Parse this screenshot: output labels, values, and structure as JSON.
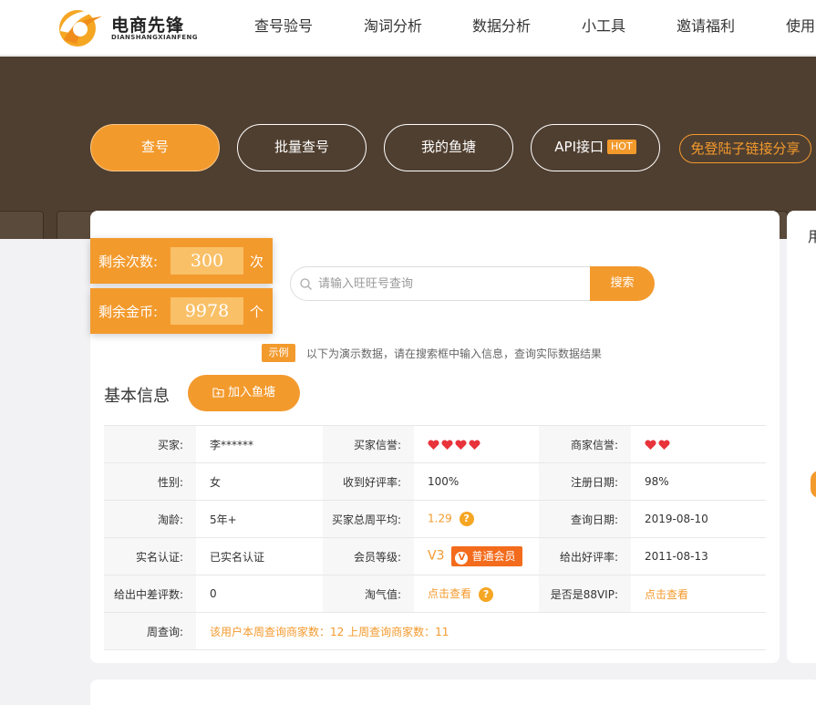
{
  "brand": {
    "name": "电商先锋",
    "sub": "DIANSHANGXIANFENG"
  },
  "nav": {
    "items": [
      "查号验号",
      "淘词分析",
      "数据分析",
      "小工具",
      "邀请福利",
      "使用"
    ]
  },
  "hero": {
    "tabs": [
      {
        "label": "查号"
      },
      {
        "label": "批量查号"
      },
      {
        "label": "我的鱼塘"
      },
      {
        "label": "API接口",
        "badge": "HOT"
      }
    ],
    "share": "免登陆子链接分享"
  },
  "stats": {
    "remaining_count": {
      "label": "剩余次数:",
      "value": "300",
      "unit": "次"
    },
    "remaining_coins": {
      "label": "剩余金币:",
      "value": "9978",
      "unit": "个"
    }
  },
  "search": {
    "placeholder": "请输入旺旺号查询",
    "button": "搜索"
  },
  "demo": {
    "tag": "示例",
    "text": "以下为演示数据，请在搜索框中输入信息，查询实际数据结果"
  },
  "basic": {
    "title": "基本信息",
    "add_button": "加入鱼塘"
  },
  "table": {
    "buyer_label": "买家:",
    "buyer": "李******",
    "buyer_credit_label": "买家信誉:",
    "seller_credit_label": "商家信誉:",
    "gender_label": "性别:",
    "gender": "女",
    "good_rate_label": "收到好评率:",
    "good_rate": "100%",
    "reg_date_label": "注册日期:",
    "reg_date": "98%",
    "age_label": "淘龄:",
    "age": "5年+",
    "weekly_avg_label": "买家总周平均:",
    "weekly_avg": "1.29",
    "query_date_label": "查询日期:",
    "query_date": "2019-08-10",
    "realname_label": "实名认证:",
    "realname": "已实名认证",
    "member_label": "会员等级:",
    "member_level": "V3",
    "member_badge": "普通会员",
    "given_good_label": "给出好评率:",
    "given_good": "2011-08-13",
    "given_bad_label": "给出中差评数:",
    "given_bad": "0",
    "taoqi_label": "淘气值:",
    "taoqi": "点击查看",
    "vip88_label": "是否是88VIP:",
    "vip88": "点击查看",
    "weekly_label": "周查询:",
    "weekly": "该用户本周查询商家数：12 上周查询商家数：11"
  },
  "side": {
    "text": "用"
  }
}
